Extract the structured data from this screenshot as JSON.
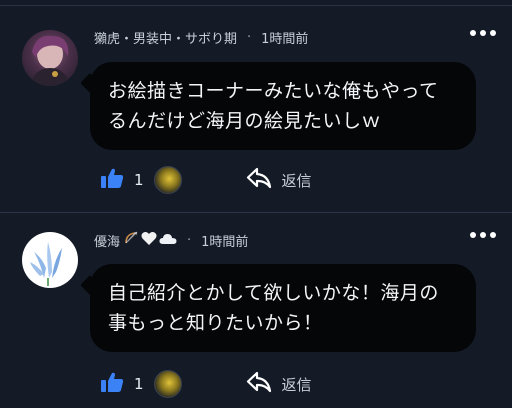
{
  "comments": [
    {
      "author": "獺虎・男装中・サボり期",
      "time": "1時間前",
      "text_line1": "お絵描きコーナーみたいな俺もやって",
      "text_line2": "るんだけど海月の絵見たいしｗ",
      "like_count": "1",
      "reply_label": "返信"
    },
    {
      "author": "優海",
      "author_emoji": [
        "bow-and-arrow",
        "white-heart",
        "cloud"
      ],
      "time": "1時間前",
      "text_line1": "自己紹介とかして欲しいかな！海月の",
      "text_line2": "事もっと知りたいから！",
      "like_count": "1",
      "reply_label": "返信"
    }
  ],
  "colors": {
    "background": "#141b27",
    "bubble": "#040608",
    "like_icon": "#3b82f6",
    "text": "#e8ecf2"
  },
  "icons": [
    "more-icon",
    "thumbs-up-icon",
    "reply-arrow-icon"
  ]
}
